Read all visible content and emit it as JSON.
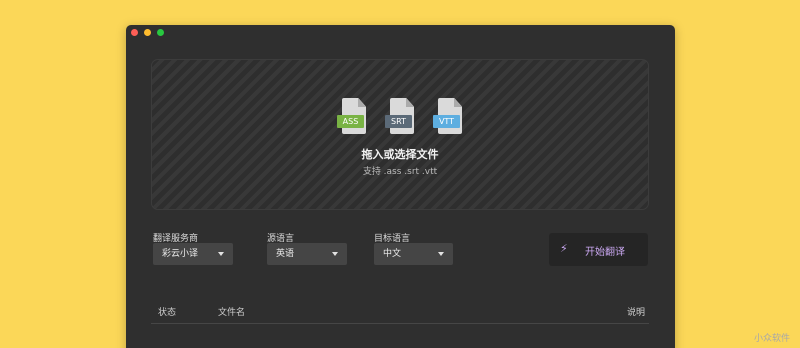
{
  "window": {
    "controls": [
      "close",
      "minimize",
      "zoom"
    ]
  },
  "dropzone": {
    "file_types": [
      {
        "label": "ASS",
        "icon": "ass-file-icon",
        "color": "#79b344"
      },
      {
        "label": "SRT",
        "icon": "srt-file-icon",
        "color": "#5b6a78"
      },
      {
        "label": "VTT",
        "icon": "vtt-file-icon",
        "color": "#5daee0"
      }
    ],
    "title": "拖入或选择文件",
    "subtitle": "支持 .ass .srt .vtt"
  },
  "service": {
    "label": "翻译服务商",
    "value": "彩云小译"
  },
  "source_lang": {
    "label": "源语言",
    "value": "英语"
  },
  "target_lang": {
    "label": "目标语言",
    "value": "中文"
  },
  "start_button": {
    "label": "开始翻译",
    "icon": "lightning-icon",
    "color": "#c9a7f0"
  },
  "table": {
    "columns": [
      "状态",
      "文件名",
      "说明"
    ]
  },
  "watermark": "小众软件",
  "colors": {
    "background": "#fbd758",
    "window": "#2f2f2f",
    "accent": "#c9a7f0"
  }
}
